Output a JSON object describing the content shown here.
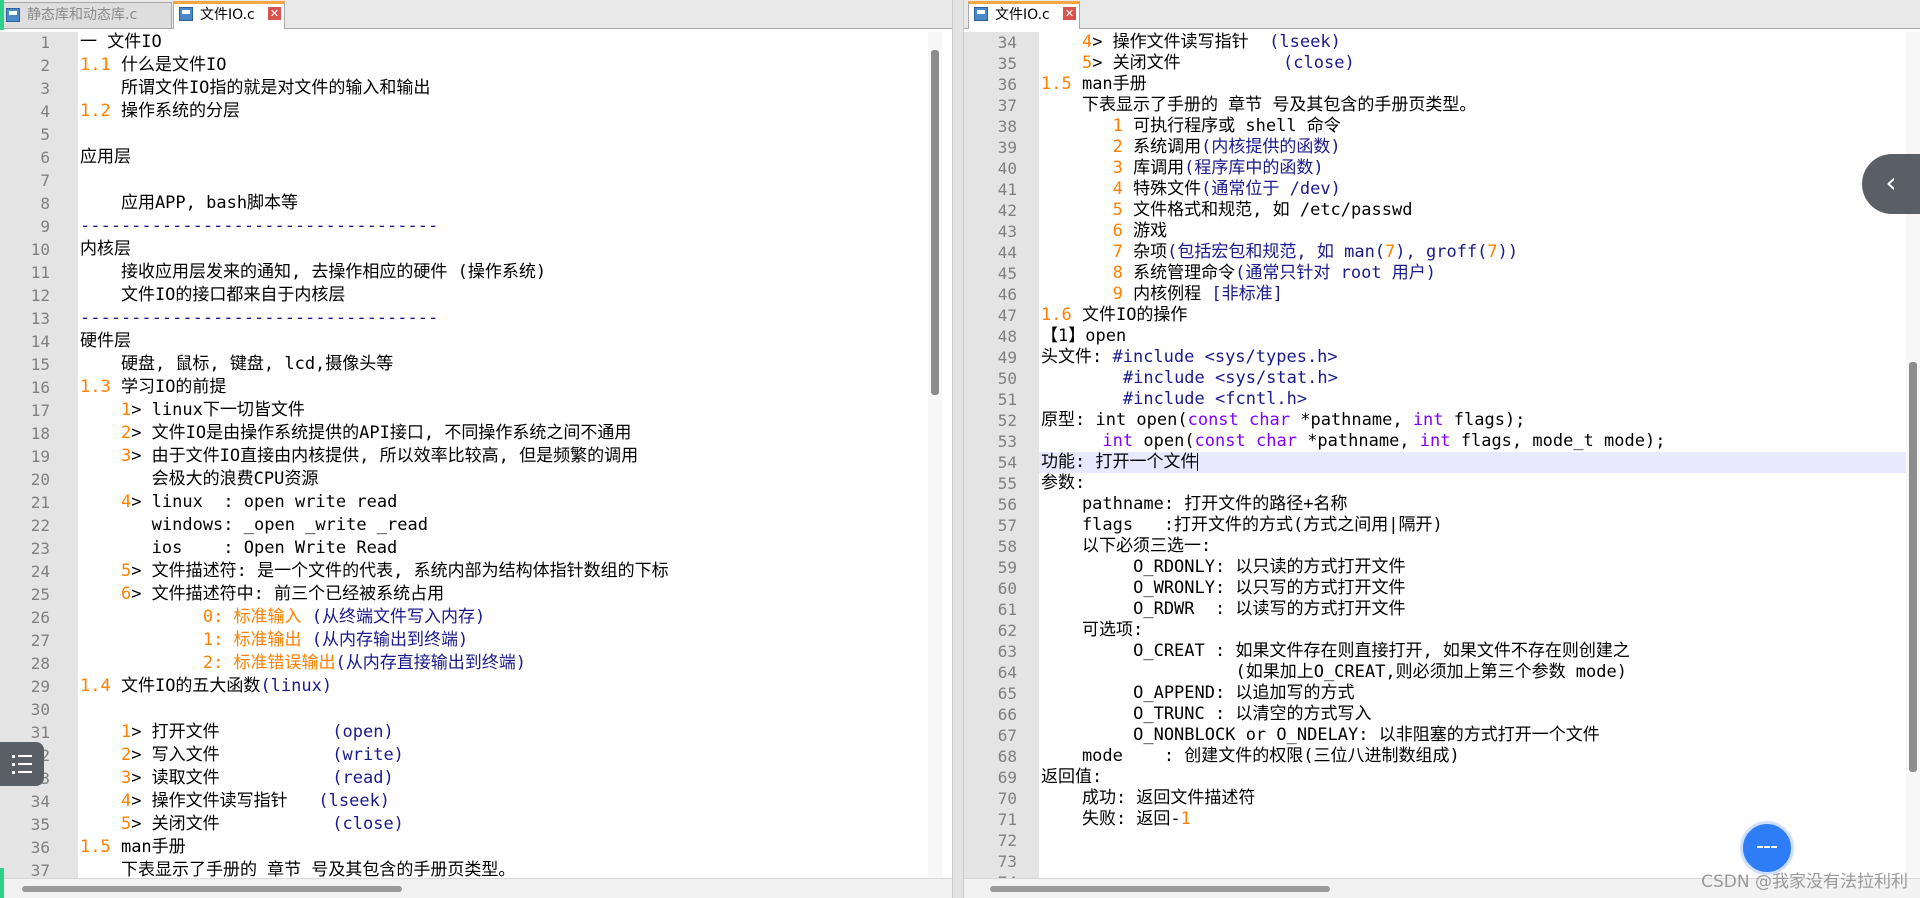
{
  "left_tabs": [
    {
      "label": "静态库和动态库.c",
      "state": "inactive"
    },
    {
      "label": "文件IO.c",
      "state": "active"
    }
  ],
  "right_tabs": [
    {
      "label": "文件IO.c",
      "state": "active"
    }
  ],
  "left_lines": [
    {
      "n": "1",
      "segs": [
        {
          "t": "一 文件IO"
        }
      ]
    },
    {
      "n": "2",
      "segs": [
        {
          "t": "1.1",
          "c": "num"
        },
        {
          "t": " 什么是文件IO"
        }
      ]
    },
    {
      "n": "3",
      "segs": [
        {
          "t": "    所谓文件IO指的就是对文件的输入和输出"
        }
      ]
    },
    {
      "n": "4",
      "segs": [
        {
          "t": "1.2",
          "c": "num"
        },
        {
          "t": " 操作系统的分层"
        }
      ]
    },
    {
      "n": "5",
      "segs": [
        {
          "t": ""
        }
      ]
    },
    {
      "n": "6",
      "segs": [
        {
          "t": "应用层"
        }
      ]
    },
    {
      "n": "7",
      "segs": [
        {
          "t": ""
        }
      ]
    },
    {
      "n": "8",
      "segs": [
        {
          "t": "    应用APP, bash脚本等"
        }
      ]
    },
    {
      "n": "9",
      "segs": [
        {
          "t": "-----------------------------------",
          "c": "cm"
        }
      ]
    },
    {
      "n": "10",
      "segs": [
        {
          "t": "内核层"
        }
      ]
    },
    {
      "n": "11",
      "segs": [
        {
          "t": "    接收应用层发来的通知, 去操作相应的硬件 (操作系统)"
        }
      ]
    },
    {
      "n": "12",
      "segs": [
        {
          "t": "    文件IO的接口都来自于内核层"
        }
      ]
    },
    {
      "n": "13",
      "segs": [
        {
          "t": "-----------------------------------",
          "c": "cm"
        }
      ]
    },
    {
      "n": "14",
      "segs": [
        {
          "t": "硬件层"
        }
      ]
    },
    {
      "n": "15",
      "segs": [
        {
          "t": "    硬盘, 鼠标, 键盘, lcd,摄像头等"
        }
      ]
    },
    {
      "n": "16",
      "segs": [
        {
          "t": "1.3",
          "c": "num"
        },
        {
          "t": " 学习IO的前提"
        }
      ]
    },
    {
      "n": "17",
      "segs": [
        {
          "t": "    "
        },
        {
          "t": "1",
          "c": "num"
        },
        {
          "t": "> linux下一切皆文件"
        }
      ]
    },
    {
      "n": "18",
      "segs": [
        {
          "t": "    "
        },
        {
          "t": "2",
          "c": "num"
        },
        {
          "t": "> 文件IO是由操作系统提供的API接口, 不同操作系统之间不通用"
        }
      ]
    },
    {
      "n": "19",
      "segs": [
        {
          "t": "    "
        },
        {
          "t": "3",
          "c": "num"
        },
        {
          "t": "> 由于文件IO直接由内核提供, 所以效率比较高, 但是频繁的调用"
        }
      ]
    },
    {
      "n": "20",
      "segs": [
        {
          "t": "       会极大的浪费CPU资源"
        }
      ]
    },
    {
      "n": "21",
      "segs": [
        {
          "t": "    "
        },
        {
          "t": "4",
          "c": "num"
        },
        {
          "t": "> linux  : open write read"
        }
      ]
    },
    {
      "n": "22",
      "segs": [
        {
          "t": "       windows: _open _write _read"
        }
      ]
    },
    {
      "n": "23",
      "segs": [
        {
          "t": "       ios    : Open Write Read"
        }
      ]
    },
    {
      "n": "24",
      "segs": [
        {
          "t": "    "
        },
        {
          "t": "5",
          "c": "num"
        },
        {
          "t": "> 文件描述符: 是一个文件的代表, 系统内部为结构体指针数组的下标"
        }
      ]
    },
    {
      "n": "25",
      "segs": [
        {
          "t": "    "
        },
        {
          "t": "6",
          "c": "num"
        },
        {
          "t": "> 文件描述符中: 前三个已经被系统占用"
        }
      ]
    },
    {
      "n": "26",
      "segs": [
        {
          "t": "            "
        },
        {
          "t": "0: 标准输入",
          "c": "num"
        },
        {
          "t": " (从终端文件写入内存)",
          "c": "cm"
        }
      ]
    },
    {
      "n": "27",
      "segs": [
        {
          "t": "            "
        },
        {
          "t": "1: 标准输出",
          "c": "num"
        },
        {
          "t": " (从内存输出到终端)",
          "c": "cm"
        }
      ]
    },
    {
      "n": "28",
      "segs": [
        {
          "t": "            "
        },
        {
          "t": "2: 标准错误输出",
          "c": "num"
        },
        {
          "t": "(从内存直接输出到终端)",
          "c": "cm"
        }
      ]
    },
    {
      "n": "29",
      "segs": [
        {
          "t": "1.4",
          "c": "num"
        },
        {
          "t": " 文件IO的五大函数"
        },
        {
          "t": "(linux)",
          "c": "cm"
        }
      ]
    },
    {
      "n": "30",
      "segs": [
        {
          "t": ""
        }
      ]
    },
    {
      "n": "31",
      "segs": [
        {
          "t": "    "
        },
        {
          "t": "1",
          "c": "num"
        },
        {
          "t": "> 打开文件           "
        },
        {
          "t": "(open)",
          "c": "cm"
        }
      ]
    },
    {
      "n": "32",
      "segs": [
        {
          "t": "    "
        },
        {
          "t": "2",
          "c": "num"
        },
        {
          "t": "> 写入文件           "
        },
        {
          "t": "(write)",
          "c": "cm"
        }
      ]
    },
    {
      "n": "33",
      "segs": [
        {
          "t": "    "
        },
        {
          "t": "3",
          "c": "num"
        },
        {
          "t": "> 读取文件           "
        },
        {
          "t": "(read)",
          "c": "cm"
        }
      ]
    },
    {
      "n": "34",
      "segs": [
        {
          "t": "    "
        },
        {
          "t": "4",
          "c": "num"
        },
        {
          "t": "> 操作文件读写指针   "
        },
        {
          "t": "(lseek)",
          "c": "cm"
        }
      ]
    },
    {
      "n": "35",
      "segs": [
        {
          "t": "    "
        },
        {
          "t": "5",
          "c": "num"
        },
        {
          "t": "> 关闭文件           "
        },
        {
          "t": "(close)",
          "c": "cm"
        }
      ]
    },
    {
      "n": "36",
      "segs": [
        {
          "t": "1.5",
          "c": "num"
        },
        {
          "t": " man手册"
        }
      ]
    },
    {
      "n": "37",
      "segs": [
        {
          "t": "    下表显示了手册的 章节 号及其包含的手册页类型。"
        }
      ]
    }
  ],
  "right_lines": [
    {
      "n": "34",
      "segs": [
        {
          "t": "    "
        },
        {
          "t": "4",
          "c": "num"
        },
        {
          "t": "> 操作文件读写指针  "
        },
        {
          "t": "(lseek)",
          "c": "cm"
        }
      ]
    },
    {
      "n": "35",
      "segs": [
        {
          "t": "    "
        },
        {
          "t": "5",
          "c": "num"
        },
        {
          "t": "> 关闭文件          "
        },
        {
          "t": "(close)",
          "c": "cm"
        }
      ]
    },
    {
      "n": "36",
      "segs": [
        {
          "t": "1.5",
          "c": "num"
        },
        {
          "t": " man手册"
        }
      ]
    },
    {
      "n": "37",
      "segs": [
        {
          "t": "    下表显示了手册的 章节 号及其包含的手册页类型。"
        }
      ]
    },
    {
      "n": "38",
      "segs": [
        {
          "t": "       "
        },
        {
          "t": "1",
          "c": "num"
        },
        {
          "t": " 可执行程序或 shell 命令"
        }
      ]
    },
    {
      "n": "39",
      "segs": [
        {
          "t": "       "
        },
        {
          "t": "2",
          "c": "num"
        },
        {
          "t": " 系统调用"
        },
        {
          "t": "(内核提供的函数)",
          "c": "cm"
        }
      ]
    },
    {
      "n": "40",
      "segs": [
        {
          "t": "       "
        },
        {
          "t": "3",
          "c": "num"
        },
        {
          "t": " 库调用"
        },
        {
          "t": "(程序库中的函数)",
          "c": "cm"
        }
      ]
    },
    {
      "n": "41",
      "segs": [
        {
          "t": "       "
        },
        {
          "t": "4",
          "c": "num"
        },
        {
          "t": " 特殊文件"
        },
        {
          "t": "(通常位于 /dev)",
          "c": "cm"
        }
      ]
    },
    {
      "n": "42",
      "segs": [
        {
          "t": "       "
        },
        {
          "t": "5",
          "c": "num"
        },
        {
          "t": " 文件格式和规范, 如 /etc/passwd"
        }
      ]
    },
    {
      "n": "43",
      "segs": [
        {
          "t": "       "
        },
        {
          "t": "6",
          "c": "num"
        },
        {
          "t": " 游戏"
        }
      ]
    },
    {
      "n": "44",
      "segs": [
        {
          "t": "       "
        },
        {
          "t": "7",
          "c": "num"
        },
        {
          "t": " 杂项"
        },
        {
          "t": "(包括宏包和规范, 如 man(",
          "c": "cm"
        },
        {
          "t": "7",
          "c": "num"
        },
        {
          "t": "), groff(",
          "c": "cm"
        },
        {
          "t": "7",
          "c": "num"
        },
        {
          "t": "))",
          "c": "cm"
        }
      ]
    },
    {
      "n": "45",
      "segs": [
        {
          "t": "       "
        },
        {
          "t": "8",
          "c": "num"
        },
        {
          "t": " 系统管理命令"
        },
        {
          "t": "(通常只针对 root 用户)",
          "c": "cm"
        }
      ]
    },
    {
      "n": "46",
      "segs": [
        {
          "t": "       "
        },
        {
          "t": "9",
          "c": "num"
        },
        {
          "t": " 内核例程 "
        },
        {
          "t": "[非标准]",
          "c": "cm"
        }
      ]
    },
    {
      "n": "47",
      "segs": [
        {
          "t": "1.6",
          "c": "num"
        },
        {
          "t": " 文件IO的操作"
        }
      ]
    },
    {
      "n": "48",
      "segs": [
        {
          "t": "【1】open"
        }
      ]
    },
    {
      "n": "49",
      "segs": [
        {
          "t": "头文件: "
        },
        {
          "t": "#include <sys/types.h>",
          "c": "hash"
        }
      ]
    },
    {
      "n": "50",
      "segs": [
        {
          "t": "        "
        },
        {
          "t": "#include <sys/stat.h>",
          "c": "hash"
        }
      ]
    },
    {
      "n": "51",
      "segs": [
        {
          "t": "        "
        },
        {
          "t": "#include <fcntl.h>",
          "c": "hash"
        }
      ]
    },
    {
      "n": "52",
      "segs": [
        {
          "t": "原型: int open("
        },
        {
          "t": "const",
          "c": "kw"
        },
        {
          "t": " "
        },
        {
          "t": "char",
          "c": "kw"
        },
        {
          "t": " *pathname, "
        },
        {
          "t": "int",
          "c": "kw"
        },
        {
          "t": " flags);"
        }
      ]
    },
    {
      "n": "53",
      "segs": [
        {
          "t": "      "
        },
        {
          "t": "int",
          "c": "kw"
        },
        {
          "t": " open("
        },
        {
          "t": "const",
          "c": "kw"
        },
        {
          "t": " "
        },
        {
          "t": "char",
          "c": "kw"
        },
        {
          "t": " *pathname, "
        },
        {
          "t": "int",
          "c": "kw"
        },
        {
          "t": " flags, mode_t mode);"
        }
      ]
    },
    {
      "n": "54",
      "segs": [
        {
          "t": "功能: 打开一个文件"
        }
      ],
      "current": true
    },
    {
      "n": "55",
      "segs": [
        {
          "t": "参数:"
        }
      ]
    },
    {
      "n": "56",
      "segs": [
        {
          "t": "    pathname: 打开文件的路径+名称"
        }
      ]
    },
    {
      "n": "57",
      "segs": [
        {
          "t": "    flags   :打开文件的方式(方式之间用|隔开)"
        }
      ]
    },
    {
      "n": "58",
      "segs": [
        {
          "t": "    以下必须三选一:"
        }
      ]
    },
    {
      "n": "59",
      "segs": [
        {
          "t": "         O_RDONLY: 以只读的方式打开文件"
        }
      ]
    },
    {
      "n": "60",
      "segs": [
        {
          "t": "         O_WRONLY: 以只写的方式打开文件"
        }
      ]
    },
    {
      "n": "61",
      "segs": [
        {
          "t": "         O_RDWR  : 以读写的方式打开文件"
        }
      ]
    },
    {
      "n": "62",
      "segs": [
        {
          "t": "    可选项:"
        }
      ]
    },
    {
      "n": "63",
      "segs": [
        {
          "t": "         O_CREAT : 如果文件存在则直接打开, 如果文件不存在则创建之"
        }
      ]
    },
    {
      "n": "64",
      "segs": [
        {
          "t": "                   (如果加上O_CREAT,则必须加上第三个参数 mode)"
        }
      ]
    },
    {
      "n": "65",
      "segs": [
        {
          "t": "         O_APPEND: 以追加写的方式"
        }
      ]
    },
    {
      "n": "66",
      "segs": [
        {
          "t": "         O_TRUNC : 以清空的方式写入"
        }
      ]
    },
    {
      "n": "67",
      "segs": [
        {
          "t": "         O_NONBLOCK or O_NDELAY: 以非阻塞的方式打开一个文件"
        }
      ]
    },
    {
      "n": "68",
      "segs": [
        {
          "t": "    mode    : 创建文件的权限(三位八进制数组成)"
        }
      ]
    },
    {
      "n": "69",
      "segs": [
        {
          "t": "返回值:"
        }
      ]
    },
    {
      "n": "70",
      "segs": [
        {
          "t": "    成功: 返回文件描述符"
        }
      ]
    },
    {
      "n": "71",
      "segs": [
        {
          "t": "    失败: 返回-"
        },
        {
          "t": "1",
          "c": "num"
        }
      ]
    },
    {
      "n": "72",
      "segs": [
        {
          "t": ""
        }
      ]
    },
    {
      "n": "73",
      "segs": [
        {
          "t": ""
        }
      ]
    },
    {
      "n": "74",
      "segs": [
        {
          "t": ""
        }
      ]
    }
  ],
  "watermark": "CSDN @我家没有法拉利利",
  "icons": {
    "tab_file": "c-file-icon",
    "tab_close": "close-icon",
    "toc": "toc-list-icon",
    "collapse": "chevron-left-icon",
    "float": "assistant-icon"
  },
  "colors": {
    "number": "#ff8000",
    "bracket_text": "#1a1a8c",
    "keyword": "#8000ff",
    "gutter": "#e4e4e4",
    "current_line": "#e8e8ff"
  }
}
